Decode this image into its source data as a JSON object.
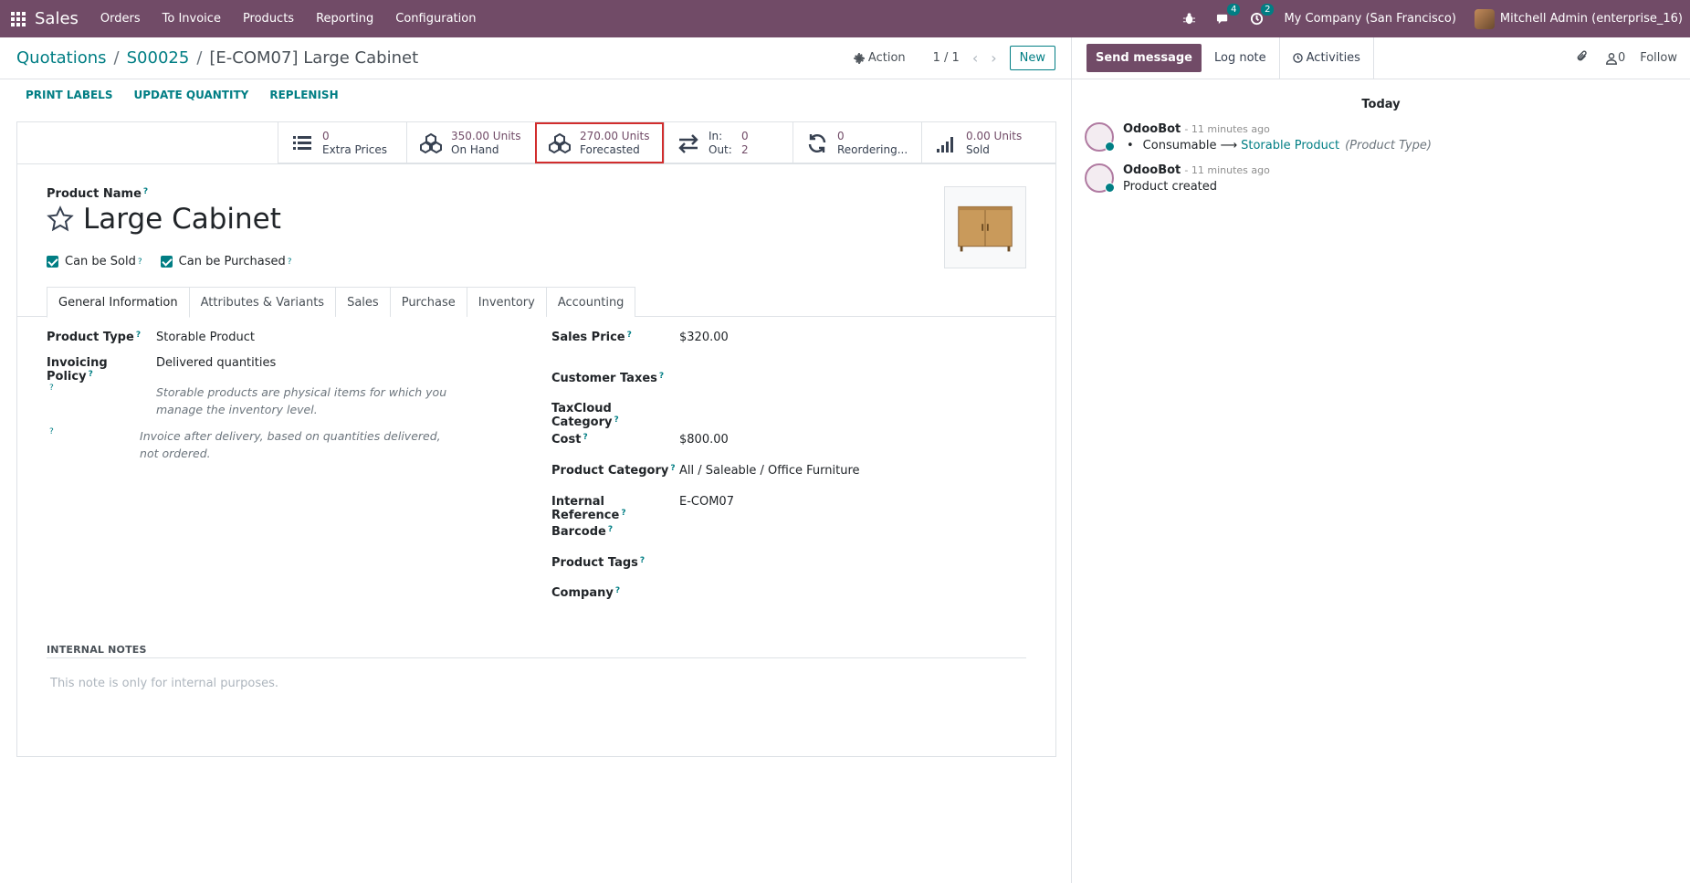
{
  "navbar": {
    "app_name": "Sales",
    "menus": [
      "Orders",
      "To Invoice",
      "Products",
      "Reporting",
      "Configuration"
    ],
    "messages_badge": "4",
    "activities_badge": "2",
    "company": "My Company (San Francisco)",
    "user": "Mitchell Admin (enterprise_16)",
    "brand_color": "#714b67"
  },
  "breadcrumb": {
    "items": [
      "Quotations",
      "S00025"
    ],
    "current": "[E-COM07] Large Cabinet"
  },
  "control": {
    "action_label": "Action",
    "pager": "1 / 1",
    "new_label": "New"
  },
  "form_buttons": [
    "PRINT LABELS",
    "UPDATE QUANTITY",
    "REPLENISH"
  ],
  "smart_buttons": [
    {
      "value": "0",
      "label": "Extra Prices",
      "icon": "list-icon"
    },
    {
      "value": "350.00 Units",
      "label": "On Hand",
      "icon": "cubes-icon"
    },
    {
      "value": "270.00 Units",
      "label": "Forecasted",
      "icon": "cubes-icon"
    },
    {
      "in_label": "In:",
      "in_value": "0",
      "out_label": "Out:",
      "out_value": "2",
      "icon": "exchange-icon"
    },
    {
      "value": "0",
      "label": "Reordering...",
      "icon": "refresh-icon"
    },
    {
      "value": "0.00 Units",
      "label": "Sold",
      "icon": "signal-icon"
    }
  ],
  "product": {
    "name_label": "Product Name",
    "name": "Large Cabinet",
    "can_be_sold": "Can be Sold",
    "can_be_purchased": "Can be Purchased"
  },
  "tabs": [
    "General Information",
    "Attributes & Variants",
    "Sales",
    "Purchase",
    "Inventory",
    "Accounting"
  ],
  "left_fields": {
    "product_type_label": "Product Type",
    "product_type": "Storable Product",
    "invoicing_policy_label": "Invoicing Policy",
    "invoicing_policy": "Delivered quantities",
    "help1": "Storable products are physical items for which you manage the inventory level.",
    "help2": "Invoice after delivery, based on quantities delivered, not ordered."
  },
  "right_fields": {
    "sales_price_label": "Sales Price",
    "sales_price": "$320.00",
    "customer_taxes_label": "Customer Taxes",
    "taxcloud_label": "TaxCloud Category",
    "cost_label": "Cost",
    "cost": "$800.00",
    "category_label": "Product Category",
    "category": "All / Saleable / Office Furniture",
    "internal_ref_label": "Internal Reference",
    "internal_ref": "E-COM07",
    "barcode_label": "Barcode",
    "tags_label": "Product Tags",
    "company_label": "Company"
  },
  "notes": {
    "label": "INTERNAL NOTES",
    "placeholder": "This note is only for internal purposes."
  },
  "chatter": {
    "send_message": "Send message",
    "log_note": "Log note",
    "activities": "Activities",
    "follower_count": "0",
    "follow": "Follow",
    "day": "Today",
    "messages": [
      {
        "author": "OdooBot",
        "time": "- 11 minutes ago",
        "old": "Consumable",
        "new": "Storable Product",
        "field": "(Product Type)"
      },
      {
        "author": "OdooBot",
        "time": "- 11 minutes ago",
        "body": "Product created"
      }
    ]
  }
}
